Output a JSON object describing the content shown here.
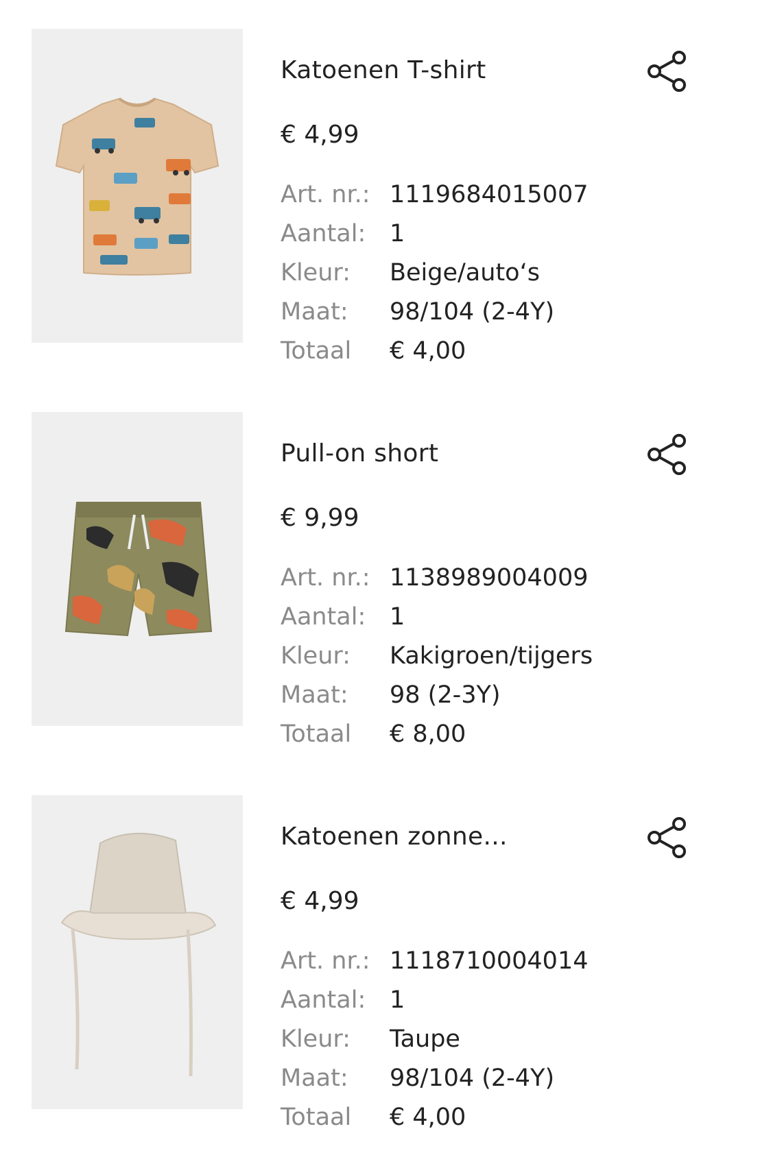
{
  "labels": {
    "art_nr": "Art. nr.:",
    "aantal": "Aantal:",
    "kleur": "Kleur:",
    "maat": "Maat:",
    "totaal": "Totaal"
  },
  "icons": {
    "share": "share-icon"
  },
  "colors": {
    "text": "#222222",
    "label": "#8a8a8a",
    "thumb_bg": "#efefef"
  },
  "items": [
    {
      "name": "Katoenen T-shirt",
      "price": "€ 4,99",
      "art_nr": "1119684015007",
      "aantal": "1",
      "kleur": "Beige/auto‘s",
      "maat": "98/104 (2-4Y)",
      "totaal": "€ 4,00",
      "image": "beige-tshirt-with-cars-print"
    },
    {
      "name": "Pull-on short",
      "price": "€ 9,99",
      "art_nr": "1138989004009",
      "aantal": "1",
      "kleur": "Kakigroen/tijgers",
      "maat": "98 (2-3Y)",
      "totaal": "€ 8,00",
      "image": "khaki-shorts-with-tiger-print"
    },
    {
      "name": "Katoenen zonne...",
      "price": "€ 4,99",
      "art_nr": "1118710004014",
      "aantal": "1",
      "kleur": "Taupe",
      "maat": "98/104 (2-4Y)",
      "totaal": "€ 4,00",
      "image": "taupe-bucket-hat"
    }
  ]
}
